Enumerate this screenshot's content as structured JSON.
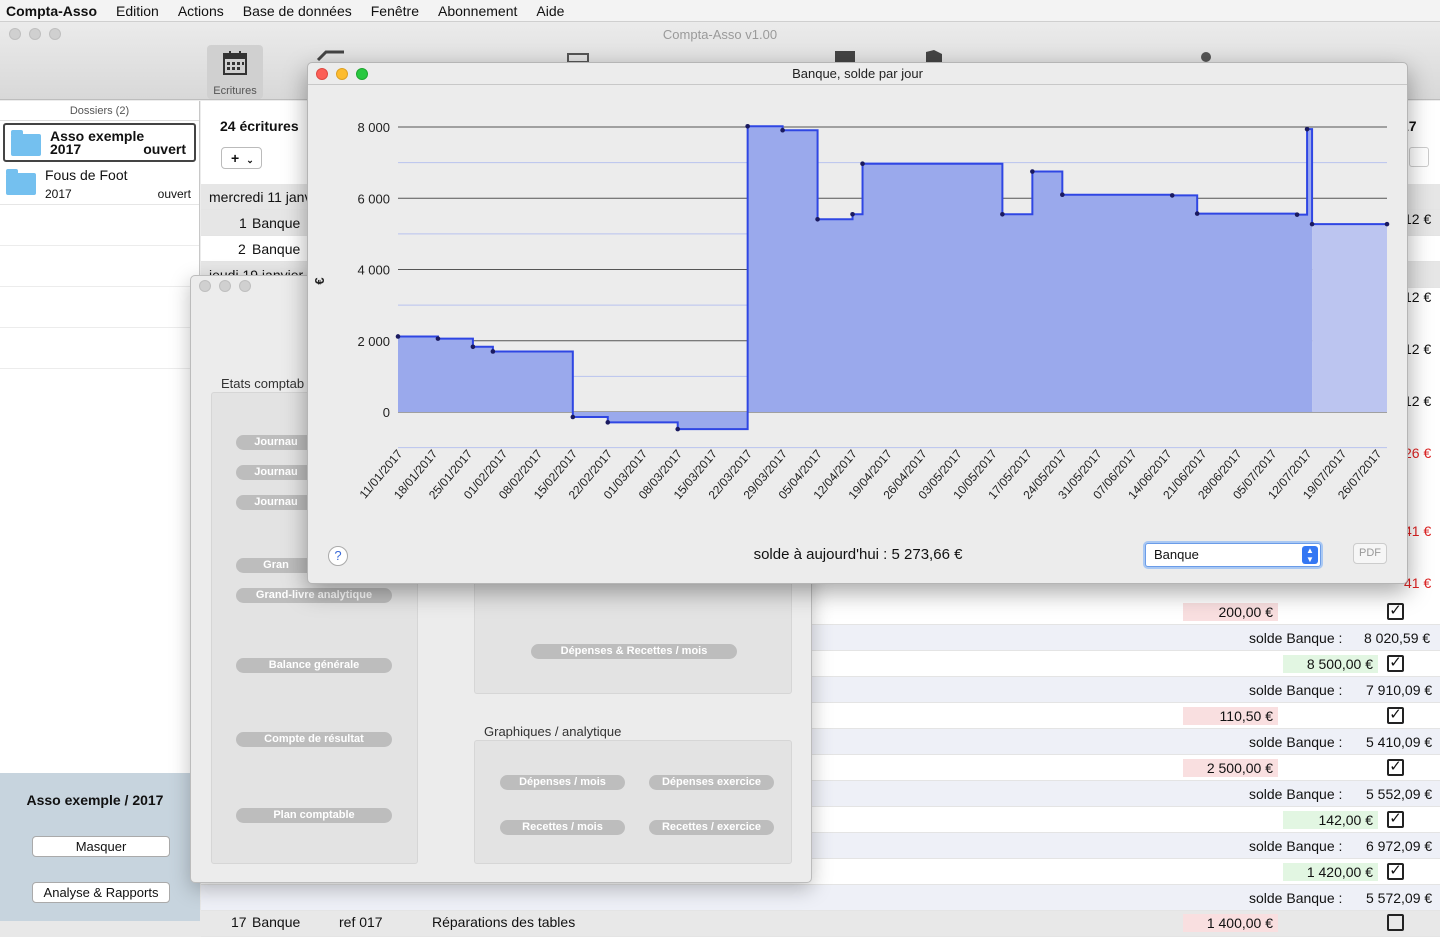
{
  "menubar": {
    "app": "Compta-Asso",
    "items": [
      "Edition",
      "Actions",
      "Base de données",
      "Fenêtre",
      "Abonnement",
      "Aide"
    ]
  },
  "main": {
    "title": "Compta-Asso v1.00",
    "toolbar_selected": "Ecritures"
  },
  "sidebar": {
    "header": "Dossiers (2)",
    "dossiers": [
      {
        "name": "Asso exemple",
        "year": "2017",
        "status": "ouvert"
      },
      {
        "name": "Fous de Foot",
        "year": "2017",
        "status": "ouvert"
      }
    ],
    "footer_title": "Asso exemple / 2017",
    "btn_hide": "Masquer",
    "btn_analyse": "Analyse & Rapports"
  },
  "list": {
    "count": "24 écritures",
    "add": "+",
    "col_right_header": "17",
    "date1": "mercredi 11 janv",
    "row1": {
      "num": "1",
      "account": "Banque"
    },
    "row2": {
      "num": "2",
      "account": "Banque"
    },
    "date2": "jeudi 19 janvier",
    "right_vals": [
      "12 €",
      "12 €",
      "12 €",
      "12 €",
      "26 €",
      "41 €",
      "41 €"
    ],
    "rows": [
      {
        "amount": "200,00 €",
        "kind": "red"
      },
      {
        "solde_label": "solde  Banque :",
        "solde": "8 020,59 €"
      },
      {
        "amount": "8 500,00 €",
        "kind": "green"
      },
      {
        "solde_label": "solde  Banque :",
        "solde": "7 910,09 €"
      },
      {
        "amount": "110,50 €",
        "kind": "red"
      },
      {
        "solde_label": "solde  Banque :",
        "solde": "5 410,09 €"
      },
      {
        "amount": "2 500,00 €",
        "kind": "red"
      },
      {
        "solde_label": "solde  Banque :",
        "solde": "5 552,09 €"
      },
      {
        "amount": "142,00 €",
        "kind": "green"
      },
      {
        "solde_label": "solde  Banque :",
        "solde": "6 972,09 €"
      },
      {
        "amount": "1 420,00 €",
        "kind": "green"
      },
      {
        "solde_label": "solde  Banque :",
        "solde": "5 572,09 €"
      }
    ],
    "last_row": {
      "num": "17",
      "account": "Banque",
      "ref": "ref 017",
      "desc": "Réparations des tables",
      "amount": "1 400,00 €"
    }
  },
  "analyse": {
    "group_left": "Etats comptab",
    "buttons_left": [
      "Journau",
      "Journau",
      "Journau",
      "Gran",
      "Grand-livre analytique",
      "Balance générale",
      "Compte de résultat",
      "Plan comptable"
    ],
    "btn_dep_rec": "Dépenses & Recettes / mois",
    "group_graph": "Graphiques / analytique",
    "btn_dep_mois": "Dépenses / mois",
    "btn_dep_ex": "Dépenses exercice",
    "btn_rec_mois": "Recettes / mois",
    "btn_rec_ex": "Recettes / exercice"
  },
  "chart_window": {
    "title": "Banque, solde par jour",
    "help": "?",
    "solde_text": "solde à aujourd'hui : 5 273,66 €",
    "account_select": "Banque",
    "pdf": "PDF"
  },
  "chart_data": {
    "type": "area",
    "title": "",
    "ylabel": "€",
    "ylim": [
      -1000,
      8300
    ],
    "yticks": [
      0,
      2000,
      4000,
      6000,
      8000
    ],
    "ytick_labels": [
      "0",
      "2 000",
      "4 000",
      "6 000",
      "8 000"
    ],
    "x_labels": [
      "11/01/2017",
      "18/01/2017",
      "25/01/2017",
      "01/02/2017",
      "08/02/2017",
      "15/02/2017",
      "22/02/2017",
      "01/03/2017",
      "08/03/2017",
      "15/03/2017",
      "22/03/2017",
      "29/03/2017",
      "05/04/2017",
      "12/04/2017",
      "19/04/2017",
      "26/04/2017",
      "03/05/2017",
      "10/05/2017",
      "17/05/2017",
      "24/05/2017",
      "31/05/2017",
      "07/06/2017",
      "14/06/2017",
      "21/06/2017",
      "28/06/2017",
      "05/07/2017",
      "12/07/2017",
      "19/07/2017",
      "26/07/2017"
    ],
    "x_start": "11/01/2017",
    "x_end": "28/07/2017",
    "steps": [
      {
        "date": "11/01/2017",
        "value": 2120
      },
      {
        "date": "19/01/2017",
        "value": 2060
      },
      {
        "date": "26/01/2017",
        "value": 1830
      },
      {
        "date": "30/01/2017",
        "value": 1700
      },
      {
        "date": "15/02/2017",
        "value": -140
      },
      {
        "date": "22/02/2017",
        "value": -290
      },
      {
        "date": "08/03/2017",
        "value": -480
      },
      {
        "date": "22/03/2017",
        "value": 8020
      },
      {
        "date": "29/03/2017",
        "value": 7910
      },
      {
        "date": "05/04/2017",
        "value": 5410
      },
      {
        "date": "12/04/2017",
        "value": 5550
      },
      {
        "date": "14/04/2017",
        "value": 6970
      },
      {
        "date": "12/05/2017",
        "value": 5550
      },
      {
        "date": "18/05/2017",
        "value": 6750
      },
      {
        "date": "24/05/2017",
        "value": 6100
      },
      {
        "date": "15/06/2017",
        "value": 6080
      },
      {
        "date": "20/06/2017",
        "value": 5570
      },
      {
        "date": "10/07/2017",
        "value": 5540
      },
      {
        "date": "12/07/2017",
        "value": 7940
      },
      {
        "date": "13/07/2017",
        "value": 5274
      },
      {
        "date": "28/07/2017",
        "value": 5274
      }
    ],
    "today": "13/07/2017",
    "fill_color": "#9aa9ec",
    "future_fill_color": "#bcc5f0",
    "line_color": "#2f46e3"
  }
}
